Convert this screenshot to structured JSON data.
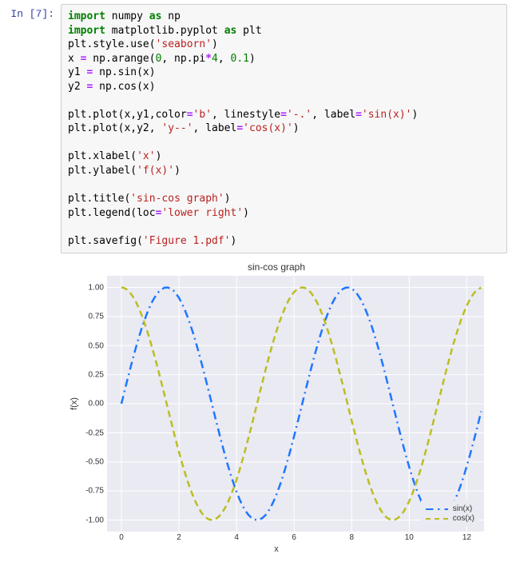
{
  "prompt": "In [7]:",
  "code": {
    "l1": {
      "a": "import",
      "b": "numpy",
      "c": "as",
      "d": "np"
    },
    "l2": {
      "a": "import",
      "b": "matplotlib.pyplot",
      "c": "as",
      "d": "plt"
    },
    "l3": {
      "obj": "plt.style.use(",
      "s": "'seaborn'",
      "end": ")"
    },
    "l4": {
      "lhs": "x ",
      "eq": "=",
      "rhs1": " np.arange(",
      "n1": "0",
      "c1": ", np.pi",
      "op": "*",
      "n2": "4",
      "c2": ", ",
      "n3": "0.1",
      "end": ")"
    },
    "l5": {
      "lhs": "y1 ",
      "eq": "=",
      "rhs": " np.sin(x)"
    },
    "l6": {
      "lhs": "y2 ",
      "eq": "=",
      "rhs": " np.cos(x)"
    },
    "l8": {
      "a": "plt.plot(x,y1,color",
      "eq": "=",
      "s1": "'b'",
      "b": ", linestyle",
      "eq2": "=",
      "s2": "'-.'",
      "c": ", label",
      "eq3": "=",
      "s3": "'sin(x)'",
      "end": ")"
    },
    "l9": {
      "a": "plt.plot(x,y2, ",
      "s1": "'y--'",
      "b": ", label",
      "eq": "=",
      "s2": "'cos(x)'",
      "end": ")"
    },
    "l11": {
      "a": "plt.xlabel(",
      "s": "'x'",
      "end": ")"
    },
    "l12": {
      "a": "plt.ylabel(",
      "s": "'f(x)'",
      "end": ")"
    },
    "l14": {
      "a": "plt.title(",
      "s": "'sin-cos graph'",
      "end": ")"
    },
    "l15": {
      "a": "plt.legend(loc",
      "eq": "=",
      "s": "'lower right'",
      "end": ")"
    },
    "l17": {
      "a": "plt.savefig(",
      "s": "'Figure 1.pdf'",
      "end": ")"
    }
  },
  "chart_data": {
    "type": "line",
    "title": "sin-cos graph",
    "xlabel": "x",
    "ylabel": "f(x)",
    "xlim": [
      -0.5,
      12.6
    ],
    "ylim": [
      -1.1,
      1.1
    ],
    "xticks": [
      0,
      2,
      4,
      6,
      8,
      10,
      12
    ],
    "yticks": [
      -1.0,
      -0.75,
      -0.5,
      -0.25,
      0.0,
      0.25,
      0.5,
      0.75,
      1.0
    ],
    "x": [
      0,
      0.1,
      0.2,
      0.3,
      0.4,
      0.5,
      0.6,
      0.7,
      0.8,
      0.9,
      1,
      1.1,
      1.2,
      1.3,
      1.4,
      1.5,
      1.6,
      1.7,
      1.8,
      1.9,
      2,
      2.1,
      2.2,
      2.3,
      2.4,
      2.5,
      2.6,
      2.7,
      2.8,
      2.9,
      3,
      3.1,
      3.2,
      3.3,
      3.4,
      3.5,
      3.6,
      3.7,
      3.8,
      3.9,
      4,
      4.1,
      4.2,
      4.3,
      4.4,
      4.5,
      4.6,
      4.7,
      4.8,
      4.9,
      5,
      5.1,
      5.2,
      5.3,
      5.4,
      5.5,
      5.6,
      5.7,
      5.8,
      5.9,
      6,
      6.1,
      6.2,
      6.3,
      6.4,
      6.5,
      6.6,
      6.7,
      6.8,
      6.9,
      7,
      7.1,
      7.2,
      7.3,
      7.4,
      7.5,
      7.6,
      7.7,
      7.8,
      7.9,
      8,
      8.1,
      8.2,
      8.3,
      8.4,
      8.5,
      8.6,
      8.7,
      8.8,
      8.9,
      9,
      9.1,
      9.2,
      9.3,
      9.4,
      9.5,
      9.6,
      9.7,
      9.8,
      9.9,
      10,
      10.1,
      10.2,
      10.3,
      10.4,
      10.5,
      10.6,
      10.7,
      10.8,
      10.9,
      11,
      11.1,
      11.2,
      11.3,
      11.4,
      11.5,
      11.6,
      11.7,
      11.8,
      11.9,
      12,
      12.1,
      12.2,
      12.3,
      12.4,
      12.5
    ],
    "series": [
      {
        "name": "sin(x)",
        "style": "dashdot",
        "color": "#1f77ff",
        "fn": "sin"
      },
      {
        "name": "cos(x)",
        "style": "dashed",
        "color": "#bcbd22",
        "fn": "cos"
      }
    ],
    "legend": {
      "position": "lower right",
      "items": [
        "sin(x)",
        "cos(x)"
      ]
    }
  }
}
